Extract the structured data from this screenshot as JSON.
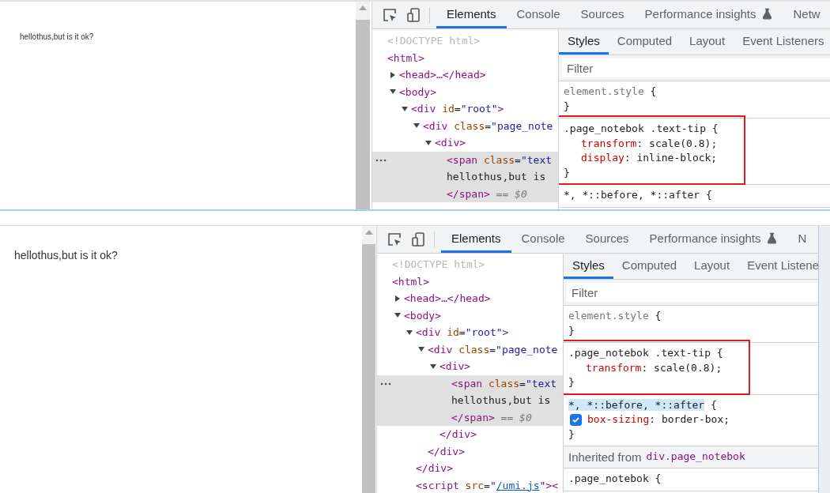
{
  "shots": [
    {
      "page": {
        "text": "hellothus,but is it ok?"
      },
      "devtools": {
        "tabs": [
          {
            "label": "Elements",
            "selected": true
          },
          {
            "label": "Console",
            "selected": false
          },
          {
            "label": "Sources",
            "selected": false
          },
          {
            "label": "Performance insights",
            "selected": false,
            "flask": true
          },
          {
            "label": "Netw",
            "selected": false
          }
        ],
        "dom": [
          {
            "selected": false,
            "tokens": [
              {
                "kind": "doctype",
                "text": "<!DOCTYPE html>"
              }
            ]
          },
          {
            "selected": false,
            "tokens": [
              {
                "kind": "tag",
                "text": "<html>"
              }
            ],
            "children": [
              {
                "expanded": false,
                "selected": false,
                "tokens": [
                  {
                    "kind": "tag",
                    "text": "<head>…</head>"
                  }
                ]
              },
              {
                "expanded": true,
                "selected": false,
                "tokens": [
                  {
                    "kind": "tag",
                    "text": "<body>"
                  }
                ],
                "children": [
                  {
                    "expanded": true,
                    "selected": false,
                    "tokens": [
                      {
                        "kind": "tag",
                        "text": "<div"
                      },
                      {
                        "kind": "attr",
                        "text": " id"
                      },
                      {
                        "kind": "plain",
                        "text": "="
                      },
                      {
                        "kind": "value",
                        "text": "\"root\""
                      },
                      {
                        "kind": "tag",
                        "text": ">"
                      }
                    ],
                    "children": [
                      {
                        "expanded": true,
                        "selected": false,
                        "tokens": [
                          {
                            "kind": "tag",
                            "text": "<div"
                          },
                          {
                            "kind": "attr",
                            "text": " class"
                          },
                          {
                            "kind": "plain",
                            "text": "="
                          },
                          {
                            "kind": "value",
                            "text": "\"page_note"
                          }
                        ],
                        "children": [
                          {
                            "expanded": true,
                            "selected": false,
                            "tokens": [
                              {
                                "kind": "tag",
                                "text": "<div>"
                              }
                            ],
                            "children": [
                              {
                                "selected": true,
                                "tokens": [
                                  {
                                    "kind": "tag",
                                    "text": "<span"
                                  },
                                  {
                                    "kind": "attr",
                                    "text": " class"
                                  },
                                  {
                                    "kind": "plain",
                                    "text": "="
                                  },
                                  {
                                    "kind": "value",
                                    "text": "\"text"
                                  }
                                ]
                              },
                              {
                                "selected": true,
                                "tokens": [
                                  {
                                    "kind": "plain",
                                    "text": "hellothus,but is"
                                  }
                                ]
                              },
                              {
                                "selected": true,
                                "tokens": [
                                  {
                                    "kind": "tag",
                                    "text": "</span>"
                                  },
                                  {
                                    "kind": "dim",
                                    "text": " == $0"
                                  }
                                ]
                              }
                            ]
                          }
                        ]
                      }
                    ]
                  }
                ]
              }
            ]
          }
        ],
        "styles_tabs": [
          {
            "label": "Styles",
            "selected": true
          },
          {
            "label": "Computed",
            "selected": false
          },
          {
            "label": "Layout",
            "selected": false
          },
          {
            "label": "Event Listeners",
            "selected": false
          }
        ],
        "filter": {
          "placeholder": "Filter"
        },
        "rules": [
          {
            "selector": "element.style",
            "inline": true,
            "highlighted": false,
            "framed": false,
            "open": "{",
            "close": "}"
          },
          {
            "selector": ".page_notebok .text-tip",
            "inline": false,
            "highlighted": false,
            "framed": true,
            "open": "{",
            "close": "}",
            "declarations": [
              {
                "prop": "transform",
                "colon": ":",
                "value": "scale(0.8);"
              },
              {
                "prop": "display",
                "colon": ":",
                "value": "inline-block;"
              }
            ]
          },
          {
            "selector": "*, *::before, *::after",
            "inline": false,
            "highlighted": false,
            "framed": false,
            "open": "{"
          }
        ]
      }
    },
    {
      "page": {
        "text": "hellothus,but is it ok?"
      },
      "devtools": {
        "tabs": [
          {
            "label": "Elements",
            "selected": true
          },
          {
            "label": "Console",
            "selected": false
          },
          {
            "label": "Sources",
            "selected": false
          },
          {
            "label": "Performance insights",
            "selected": false,
            "flask": true
          },
          {
            "label": "N",
            "selected": false
          }
        ],
        "dom": [
          {
            "selected": false,
            "tokens": [
              {
                "kind": "doctype",
                "text": "<!DOCTYPE html>"
              }
            ]
          },
          {
            "selected": false,
            "tokens": [
              {
                "kind": "tag",
                "text": "<html>"
              }
            ],
            "children": [
              {
                "expanded": false,
                "selected": false,
                "tokens": [
                  {
                    "kind": "tag",
                    "text": "<head>…</head>"
                  }
                ]
              },
              {
                "expanded": true,
                "selected": false,
                "tokens": [
                  {
                    "kind": "tag",
                    "text": "<body>"
                  }
                ],
                "children": [
                  {
                    "expanded": true,
                    "selected": false,
                    "tokens": [
                      {
                        "kind": "tag",
                        "text": "<div"
                      },
                      {
                        "kind": "attr",
                        "text": " id"
                      },
                      {
                        "kind": "plain",
                        "text": "="
                      },
                      {
                        "kind": "value",
                        "text": "\"root\""
                      },
                      {
                        "kind": "tag",
                        "text": ">"
                      }
                    ],
                    "children": [
                      {
                        "expanded": true,
                        "selected": false,
                        "tokens": [
                          {
                            "kind": "tag",
                            "text": "<div"
                          },
                          {
                            "kind": "attr",
                            "text": " class"
                          },
                          {
                            "kind": "plain",
                            "text": "="
                          },
                          {
                            "kind": "value",
                            "text": "\"page_note"
                          }
                        ],
                        "children": [
                          {
                            "expanded": true,
                            "selected": false,
                            "tokens": [
                              {
                                "kind": "tag",
                                "text": "<div>"
                              }
                            ],
                            "children": [
                              {
                                "selected": true,
                                "tokens": [
                                  {
                                    "kind": "tag",
                                    "text": "<span"
                                  },
                                  {
                                    "kind": "attr",
                                    "text": " class"
                                  },
                                  {
                                    "kind": "plain",
                                    "text": "="
                                  },
                                  {
                                    "kind": "value",
                                    "text": "\"text"
                                  }
                                ]
                              },
                              {
                                "selected": true,
                                "tokens": [
                                  {
                                    "kind": "plain",
                                    "text": "hellothus,but is"
                                  }
                                ]
                              },
                              {
                                "selected": true,
                                "tokens": [
                                  {
                                    "kind": "tag",
                                    "text": "</span>"
                                  },
                                  {
                                    "kind": "dim",
                                    "text": " == $0"
                                  }
                                ]
                              }
                            ]
                          },
                          {
                            "selected": false,
                            "tokens": [
                              {
                                "kind": "tag",
                                "text": "</div>"
                              }
                            ]
                          }
                        ]
                      },
                      {
                        "selected": false,
                        "tokens": [
                          {
                            "kind": "tag",
                            "text": "</div>"
                          }
                        ]
                      }
                    ]
                  },
                  {
                    "selected": false,
                    "tokens": [
                      {
                        "kind": "tag",
                        "text": "</div>"
                      }
                    ]
                  },
                  {
                    "selected": false,
                    "tokens": [
                      {
                        "kind": "tag",
                        "text": "<script"
                      },
                      {
                        "kind": "attr",
                        "text": " src"
                      },
                      {
                        "kind": "plain",
                        "text": "="
                      },
                      {
                        "kind": "value",
                        "text": "\""
                      },
                      {
                        "kind": "link",
                        "text": "/umi.js"
                      },
                      {
                        "kind": "value",
                        "text": "\""
                      },
                      {
                        "kind": "tag",
                        "text": "><"
                      }
                    ]
                  }
                ]
              }
            ]
          }
        ],
        "styles_tabs": [
          {
            "label": "Styles",
            "selected": true
          },
          {
            "label": "Computed",
            "selected": false
          },
          {
            "label": "Layout",
            "selected": false
          },
          {
            "label": "Event Listene",
            "selected": false
          }
        ],
        "filter": {
          "placeholder": "Filter"
        },
        "rules": [
          {
            "selector": "element.style",
            "inline": true,
            "highlighted": false,
            "framed": false,
            "open": "{",
            "close": "}"
          },
          {
            "selector": ".page_notebok .text-tip",
            "inline": false,
            "highlighted": false,
            "framed": true,
            "open": "{",
            "close": "}",
            "declarations": [
              {
                "prop": "transform",
                "colon": ":",
                "value": "scale(0.8);"
              }
            ]
          },
          {
            "selector": "*, *::before, *::after",
            "inline": false,
            "highlighted": true,
            "framed": false,
            "open": "{",
            "close": "}",
            "declarations": [
              {
                "prop": "box-sizing",
                "colon": ":",
                "value": "border-box;",
                "checked": true
              }
            ]
          }
        ],
        "inherited": {
          "label": "Inherited from",
          "source": "div.page_notebok"
        },
        "inherited_rules": [
          {
            "selector": ".page_notebok",
            "inline": false,
            "highlighted": false,
            "framed": false,
            "open": "{"
          }
        ]
      }
    }
  ]
}
